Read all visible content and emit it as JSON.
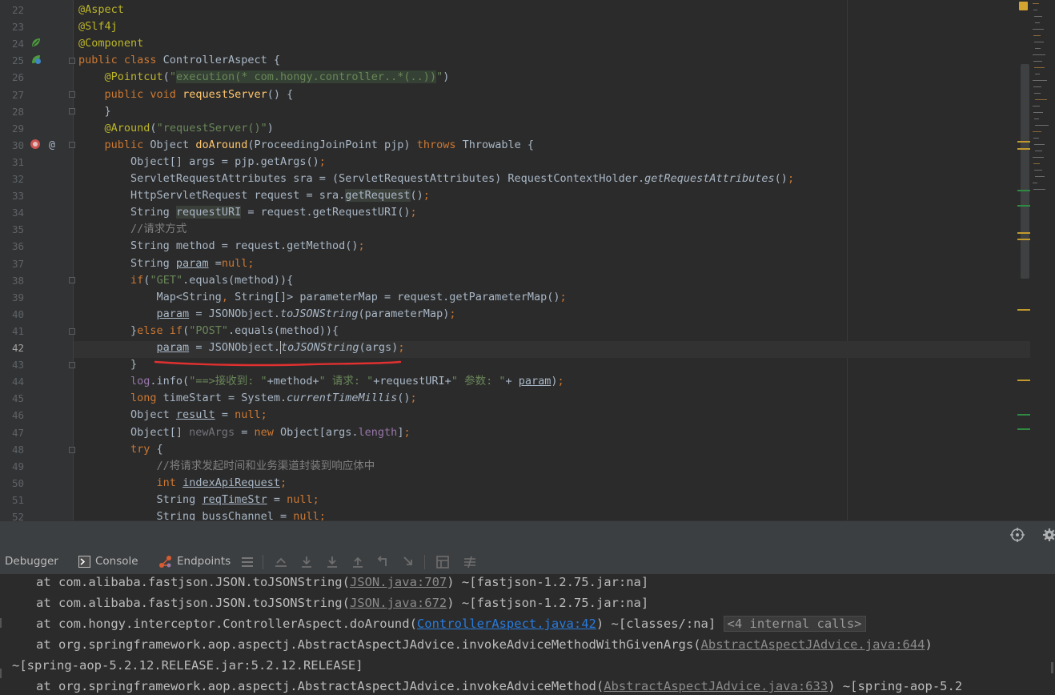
{
  "editor": {
    "current_line": 42,
    "line_numbers": [
      "22",
      "23",
      "24",
      "25",
      "26",
      "27",
      "28",
      "29",
      "30",
      "31",
      "32",
      "33",
      "34",
      "35",
      "36",
      "37",
      "38",
      "39",
      "40",
      "41",
      "42",
      "43",
      "44",
      "45",
      "46",
      "47",
      "48",
      "49",
      "50",
      "51",
      "52"
    ],
    "lines": [
      [
        {
          "t": "@Aspect",
          "c": "ann"
        }
      ],
      [
        {
          "t": "@Slf4j",
          "c": "ann"
        }
      ],
      [
        {
          "t": "@Component",
          "c": "ann"
        }
      ],
      [
        {
          "t": "public class ",
          "c": "kw"
        },
        {
          "t": "ControllerAspect {"
        }
      ],
      [
        {
          "t": "    "
        },
        {
          "t": "@Pointcut",
          "c": "ann"
        },
        {
          "t": "("
        },
        {
          "t": "\"",
          "c": "str"
        },
        {
          "t": "execution",
          "c": "str hl"
        },
        {
          "t": "(* com.hongy.controller..*(..))",
          "c": "str hl"
        },
        {
          "t": "\"",
          "c": "str"
        },
        {
          "t": ")"
        }
      ],
      [
        {
          "t": "    "
        },
        {
          "t": "public void ",
          "c": "kw"
        },
        {
          "t": "requestServer",
          "c": "fn"
        },
        {
          "t": "() {"
        }
      ],
      [
        {
          "t": "    }"
        }
      ],
      [
        {
          "t": "    "
        },
        {
          "t": "@Around",
          "c": "ann"
        },
        {
          "t": "("
        },
        {
          "t": "\"requestServer()\"",
          "c": "str"
        },
        {
          "t": ")"
        }
      ],
      [
        {
          "t": "    "
        },
        {
          "t": "public ",
          "c": "kw"
        },
        {
          "t": "Object "
        },
        {
          "t": "doAround",
          "c": "fn"
        },
        {
          "t": "(ProceedingJoinPoint pjp) "
        },
        {
          "t": "throws ",
          "c": "kw"
        },
        {
          "t": "Throwable {"
        }
      ],
      [
        {
          "t": "        Object[] args = pjp.getArgs()"
        },
        {
          "t": ";",
          "c": "kw"
        }
      ],
      [
        {
          "t": "        ServletRequestAttributes sra = (ServletRequestAttributes) RequestContextHolder."
        },
        {
          "t": "getRequestAttributes",
          "c": "it"
        },
        {
          "t": "()"
        },
        {
          "t": ";",
          "c": "kw"
        }
      ],
      [
        {
          "t": "        HttpServletRequest request = sra."
        },
        {
          "t": "getRequest",
          "c": "hl2"
        },
        {
          "t": "()"
        },
        {
          "t": ";",
          "c": "kw"
        }
      ],
      [
        {
          "t": "        String "
        },
        {
          "t": "requestURI",
          "c": "hl2"
        },
        {
          "t": " = request.getRequestURI()"
        },
        {
          "t": ";",
          "c": "kw"
        }
      ],
      [
        {
          "t": "        //请求方式",
          "c": "cm"
        }
      ],
      [
        {
          "t": "        String method = request.getMethod()"
        },
        {
          "t": ";",
          "c": "kw"
        }
      ],
      [
        {
          "t": "        String "
        },
        {
          "t": "param",
          "c": "ul"
        },
        {
          "t": " ="
        },
        {
          "t": "null;",
          "c": "kw"
        }
      ],
      [
        {
          "t": "        "
        },
        {
          "t": "if",
          "c": "kw"
        },
        {
          "t": "("
        },
        {
          "t": "\"GET\"",
          "c": "str"
        },
        {
          "t": ".equals(method)){"
        }
      ],
      [
        {
          "t": "            Map<String"
        },
        {
          "t": ", ",
          "c": "kw"
        },
        {
          "t": "String[]> parameterMap = request.getParameterMap()"
        },
        {
          "t": ";",
          "c": "kw"
        }
      ],
      [
        {
          "t": "            "
        },
        {
          "t": "param",
          "c": "ul"
        },
        {
          "t": " = JSONObject."
        },
        {
          "t": "toJSONString",
          "c": "it"
        },
        {
          "t": "(parameterMap)"
        },
        {
          "t": ";",
          "c": "kw"
        }
      ],
      [
        {
          "t": "        }"
        },
        {
          "t": "else if",
          "c": "kw"
        },
        {
          "t": "("
        },
        {
          "t": "\"POST\"",
          "c": "str"
        },
        {
          "t": ".equals(method)){"
        }
      ],
      [
        {
          "t": "            "
        },
        {
          "t": "param",
          "c": "ul"
        },
        {
          "t": " = JSONObject."
        },
        {
          "t": "toJSONString",
          "c": "it caret"
        },
        {
          "t": "(args)"
        },
        {
          "t": ";",
          "c": "kw"
        }
      ],
      [
        {
          "t": "        }"
        }
      ],
      [
        {
          "t": "        "
        },
        {
          "t": "log",
          "c": "sf"
        },
        {
          "t": ".info("
        },
        {
          "t": "\"==>接收到: \"",
          "c": "str"
        },
        {
          "t": "+method+"
        },
        {
          "t": "\" 请求: \"",
          "c": "str"
        },
        {
          "t": "+requestURI+"
        },
        {
          "t": "\" 参数: \"",
          "c": "str"
        },
        {
          "t": "+ "
        },
        {
          "t": "param",
          "c": "ul"
        },
        {
          "t": ")"
        },
        {
          "t": ";",
          "c": "kw"
        }
      ],
      [
        {
          "t": "        "
        },
        {
          "t": "long ",
          "c": "kw"
        },
        {
          "t": "timeStart = System."
        },
        {
          "t": "currentTimeMillis",
          "c": "it"
        },
        {
          "t": "()"
        },
        {
          "t": ";",
          "c": "kw"
        }
      ],
      [
        {
          "t": "        Object "
        },
        {
          "t": "result",
          "c": "ul"
        },
        {
          "t": " = "
        },
        {
          "t": "null;",
          "c": "kw"
        }
      ],
      [
        {
          "t": "        Object[] "
        },
        {
          "t": "newArgs",
          "c": "gr"
        },
        {
          "t": " = "
        },
        {
          "t": "new ",
          "c": "kw"
        },
        {
          "t": "Object[args."
        },
        {
          "t": "length",
          "c": "sf"
        },
        {
          "t": "]"
        },
        {
          "t": ";",
          "c": "kw"
        }
      ],
      [
        {
          "t": "        "
        },
        {
          "t": "try ",
          "c": "kw"
        },
        {
          "t": "{"
        }
      ],
      [
        {
          "t": "            //将请求发起时间和业务渠道封装到响应体中",
          "c": "cm"
        }
      ],
      [
        {
          "t": "            "
        },
        {
          "t": "int ",
          "c": "kw"
        },
        {
          "t": "indexApiRequest",
          "c": "ul"
        },
        {
          "t": ";",
          "c": "kw"
        }
      ],
      [
        {
          "t": "            String "
        },
        {
          "t": "reqTimeStr",
          "c": "ul"
        },
        {
          "t": " = "
        },
        {
          "t": "null;",
          "c": "kw"
        }
      ],
      [
        {
          "t": "            String bussChannel = "
        },
        {
          "t": "null;",
          "c": "kw"
        }
      ]
    ]
  },
  "tabs": {
    "debugger": "Debugger",
    "console": "Console",
    "endpoints": "Endpoints"
  },
  "console": {
    "lines": [
      [
        {
          "t": "at com.alibaba.fastjson.JSON.toJSONString("
        },
        {
          "t": "JSON.java:707",
          "c": "lnk"
        },
        {
          "t": ") ~[fastjson-1.2.75.jar:na]"
        }
      ],
      [
        {
          "t": "at com.alibaba.fastjson.JSON.toJSONString("
        },
        {
          "t": "JSON.java:672",
          "c": "lnk"
        },
        {
          "t": ") ~[fastjson-1.2.75.jar:na]"
        }
      ],
      [
        {
          "t": "at com.hongy.interceptor.ControllerAspect.doAround("
        },
        {
          "t": "ControllerAspect.java:42",
          "c": "lnk-blue"
        },
        {
          "t": ") ~[classes/:na] "
        },
        {
          "t": "<4 internal calls>",
          "c": "fold-box"
        }
      ],
      [
        {
          "t": "at org.springframework.aop.aspectj.AbstractAspectJAdvice.invokeAdviceMethodWithGivenArgs("
        },
        {
          "t": "AbstractAspectJAdvice.java:644",
          "c": "lnk"
        },
        {
          "t": ")"
        }
      ],
      [
        {
          "t": "~[spring-aop-5.2.12.RELEASE.jar:5.2.12.RELEASE]"
        }
      ],
      [
        {
          "t": "at org.springframework.aop.aspectj.AbstractAspectJAdvice.invokeAdviceMethod("
        },
        {
          "t": "AbstractAspectJAdvice.java:633",
          "c": "lnk"
        },
        {
          "t": ") ~[spring-aop-5.2"
        }
      ]
    ]
  },
  "colors": {
    "background": "#2b2b2b",
    "keyword": "#cc7832",
    "annotation": "#bbb529",
    "string": "#6a8759",
    "method": "#ffc66d",
    "link": "#287bde",
    "underline_mark": "#e03030"
  }
}
